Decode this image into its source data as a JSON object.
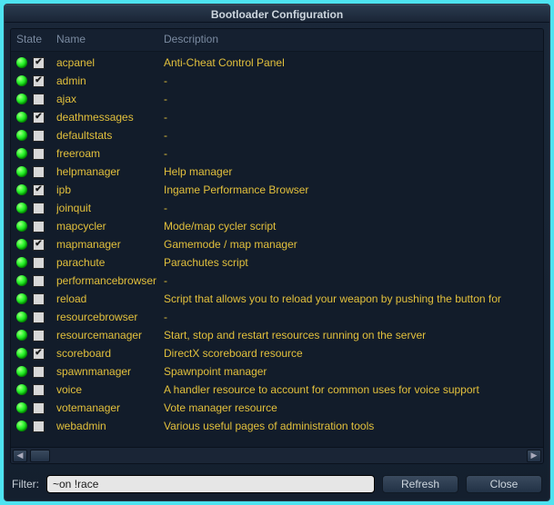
{
  "title": "Bootloader Configuration",
  "columns": {
    "state": "State",
    "name": "Name",
    "description": "Description"
  },
  "rows": [
    {
      "checked": true,
      "name": "acpanel",
      "description": "Anti-Cheat Control Panel"
    },
    {
      "checked": true,
      "name": "admin",
      "description": "-"
    },
    {
      "checked": false,
      "name": "ajax",
      "description": "-"
    },
    {
      "checked": true,
      "name": "deathmessages",
      "description": "-"
    },
    {
      "checked": false,
      "name": "defaultstats",
      "description": "-"
    },
    {
      "checked": false,
      "name": "freeroam",
      "description": "-"
    },
    {
      "checked": false,
      "name": "helpmanager",
      "description": "Help manager"
    },
    {
      "checked": true,
      "name": "ipb",
      "description": "Ingame Performance Browser"
    },
    {
      "checked": false,
      "name": "joinquit",
      "description": "-"
    },
    {
      "checked": false,
      "name": "mapcycler",
      "description": "Mode/map cycler script"
    },
    {
      "checked": true,
      "name": "mapmanager",
      "description": "Gamemode / map manager"
    },
    {
      "checked": false,
      "name": "parachute",
      "description": "Parachutes script"
    },
    {
      "checked": false,
      "name": "performancebrowser",
      "description": "-"
    },
    {
      "checked": false,
      "name": "reload",
      "description": "Script that allows you to reload your weapon by pushing the button for"
    },
    {
      "checked": false,
      "name": "resourcebrowser",
      "description": "-"
    },
    {
      "checked": false,
      "name": "resourcemanager",
      "description": "Start, stop and restart resources running on the server"
    },
    {
      "checked": true,
      "name": "scoreboard",
      "description": "DirectX scoreboard resource"
    },
    {
      "checked": false,
      "name": "spawnmanager",
      "description": "Spawnpoint manager"
    },
    {
      "checked": false,
      "name": "voice",
      "description": "A handler resource to account for common uses for voice support"
    },
    {
      "checked": false,
      "name": "votemanager",
      "description": "Vote manager resource"
    },
    {
      "checked": false,
      "name": "webadmin",
      "description": "Various useful pages of administration tools"
    }
  ],
  "footer": {
    "filter_label": "Filter:",
    "filter_value": "~on !race",
    "refresh": "Refresh",
    "close": "Close"
  },
  "glyphs": {
    "check": "✔",
    "left": "◀",
    "right": "▶"
  }
}
